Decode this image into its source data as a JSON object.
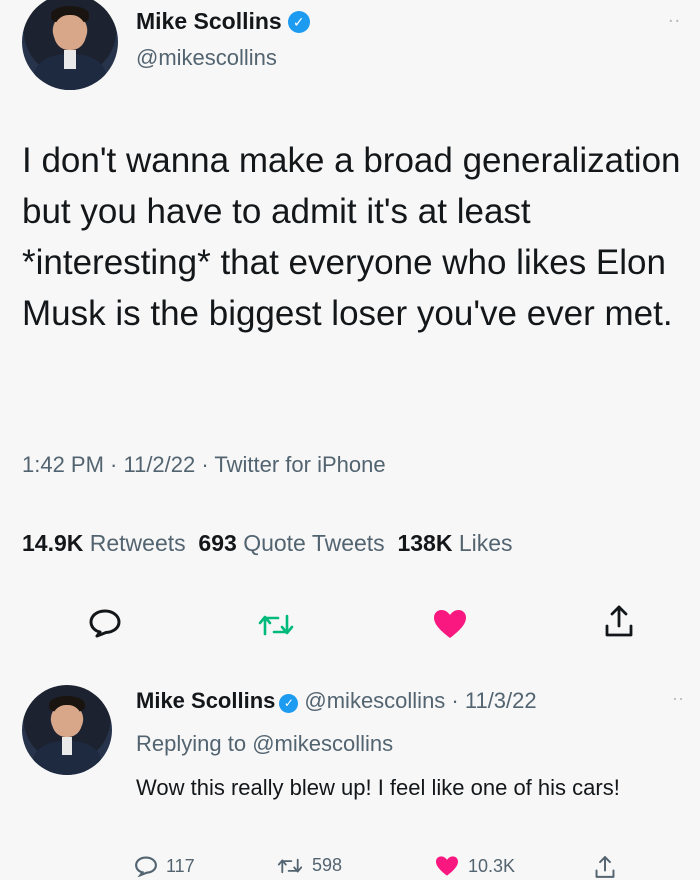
{
  "tweet": {
    "author_name": "Mike Scollins",
    "handle": "@mikescollins",
    "more": "..",
    "text": "I don't wanna make a broad generalization but you have to admit it's at least *interesting* that everyone who likes Elon Musk is the biggest loser you've ever met.",
    "meta": "1:42 PM · 11/2/22 · Twitter for iPhone",
    "stats": {
      "retweets_count": "14.9K",
      "retweets_label": "Retweets",
      "quotes_count": "693",
      "quotes_label": "Quote Tweets",
      "likes_count": "138K",
      "likes_label": "Likes"
    },
    "icons": {
      "reply": "reply-icon",
      "retweet": "retweet-icon",
      "like": "like-heart-icon",
      "share": "share-icon"
    }
  },
  "reply": {
    "author_name": "Mike Scollins",
    "handle_date": "@mikescollins · 11/3/22",
    "more": "··",
    "replying_prefix": "Replying to",
    "replying_to": "@mikescollins",
    "text": "Wow this really blew up! I feel like one of his cars!",
    "counts": {
      "replies": "117",
      "retweets": "598",
      "likes": "10.3K"
    }
  },
  "colors": {
    "verified": "#1d9bf0",
    "like": "#f91880",
    "retweet": "#00ba7c",
    "text": "#14171a",
    "secondary": "#536471"
  }
}
